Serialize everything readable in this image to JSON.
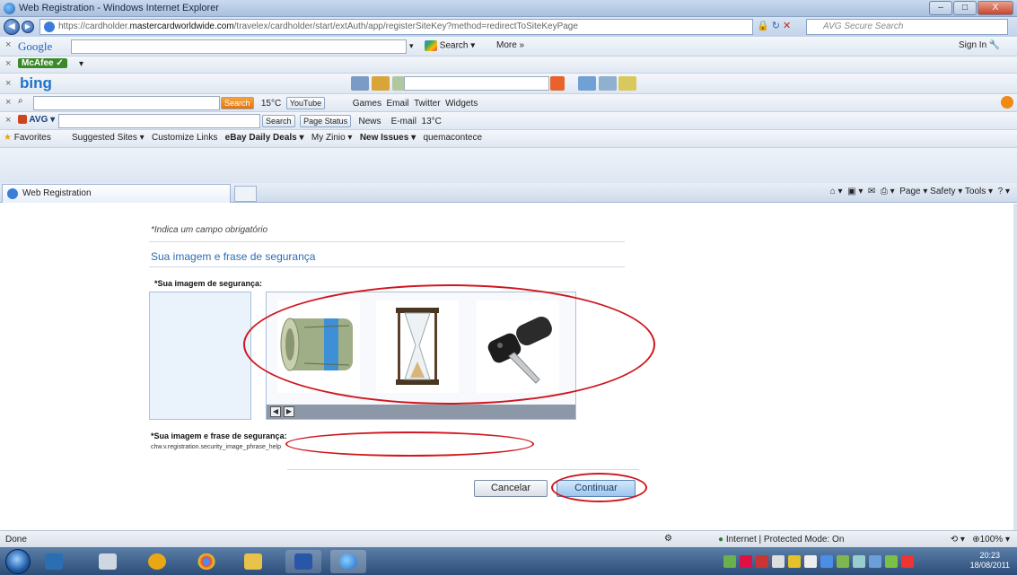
{
  "window": {
    "title": "Web Registration - Windows Internet Explorer",
    "controls": [
      "–",
      "□",
      "X"
    ]
  },
  "address_bar": {
    "url_prefix": "https://cardholder.",
    "url_domain": "mastercardworldwide.com",
    "url_path": "/travelex/cardholder/start/extAuth/app/registerSiteKey?method=redirectToSiteKeyPage",
    "search_placeholder": "AVG Secure Search"
  },
  "toolbars": {
    "google": {
      "brand": "Google",
      "search_label": "Search ▾",
      "more_label": "More »",
      "sign_in": "Sign In"
    },
    "mcafee": {
      "brand": "McAfee"
    },
    "bing": {
      "brand": "bing"
    },
    "search_bar": {
      "search_btn": "Search",
      "weather": "15°C",
      "youtube": "YouTube",
      "games": "Games",
      "email": "Email",
      "twitter": "Twitter",
      "widgets": "Widgets"
    },
    "avg": {
      "brand": "AVG",
      "search_btn": "Search",
      "page_status": "Page Status",
      "news": "News",
      "email": "E-mail",
      "weather": "13°C"
    },
    "favorites": {
      "label": "Favorites",
      "links": [
        "Suggested Sites ▾",
        "Customize Links",
        "eBay Daily Deals ▾",
        "My Zinio ▾",
        "New Issues ▾",
        "quemacontece"
      ]
    }
  },
  "tabs": {
    "active": "Web Registration",
    "commands": "Page ▾   Safety ▾   Tools ▾"
  },
  "form": {
    "required_note": "*Indica um campo obrigatório",
    "section_title": "Sua imagem e frase de segurança",
    "image_label": "*Sua imagem de segurança:",
    "images": [
      "money-roll",
      "hourglass",
      "car-key"
    ],
    "phrase_label": "*Sua imagem e frase de segurança:",
    "phrase_help": "chw.v.registration.security_image_phrase_help",
    "phrase_value": "",
    "cancel_label": "Cancelar",
    "continue_label": "Continuar"
  },
  "status_bar": {
    "left": "Done",
    "zone": "Internet | Protected Mode: On",
    "zoom": "100%"
  },
  "taskbar": {
    "time": "20:23",
    "date": "18/08/2011"
  },
  "colors": {
    "accent_blue": "#2c6cb3",
    "annotation_red": "#d0171e"
  }
}
